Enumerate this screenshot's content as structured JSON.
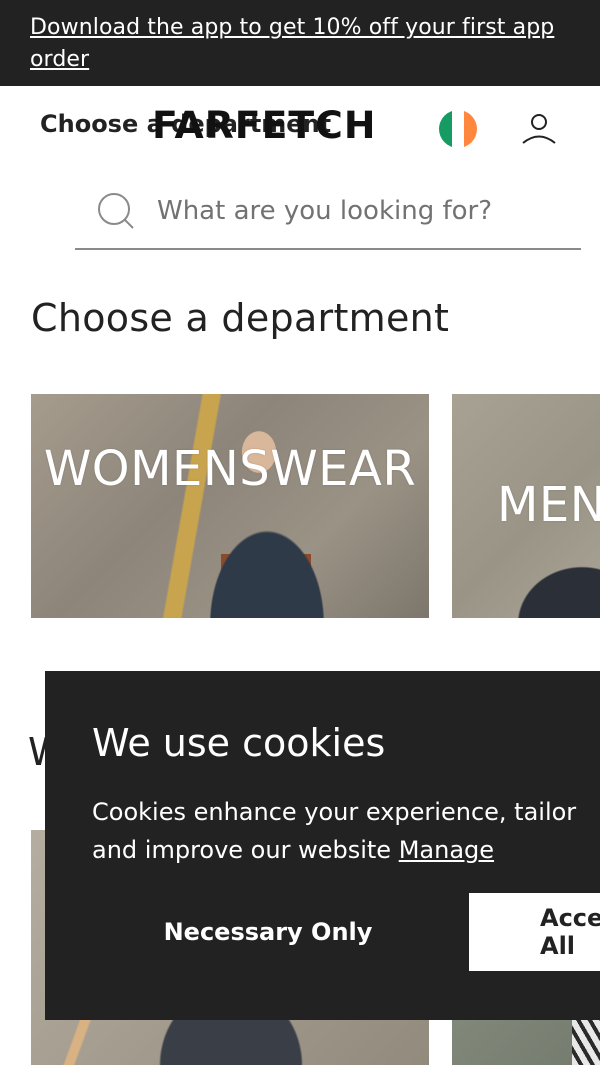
{
  "promo": {
    "text": "Download the app to get 10% off your first app order"
  },
  "header": {
    "department_toggle": "Choose a department",
    "logo": "FARFETCH",
    "flag": {
      "country": "Ireland",
      "colors": [
        "#169b62",
        "#ffffff",
        "#ff883e"
      ]
    },
    "account_icon": "user-icon"
  },
  "search": {
    "icon": "search-icon",
    "placeholder": "What are you looking for?"
  },
  "main": {
    "title": "Choose a department",
    "departments": [
      {
        "label": "WOMENSWEAR"
      },
      {
        "label": "MENSWEAR"
      }
    ],
    "partial_heading": "W"
  },
  "cookie_banner": {
    "title": "We use cookies",
    "body": "Cookies enhance your experience, tailor",
    "body_line2": "and improve our website",
    "manage_link": "Manage",
    "necessary_button": "Necessary Only",
    "accept_button": "Accept All"
  },
  "colors": {
    "banner_bg": "#222222",
    "text": "#222222",
    "white": "#ffffff"
  }
}
